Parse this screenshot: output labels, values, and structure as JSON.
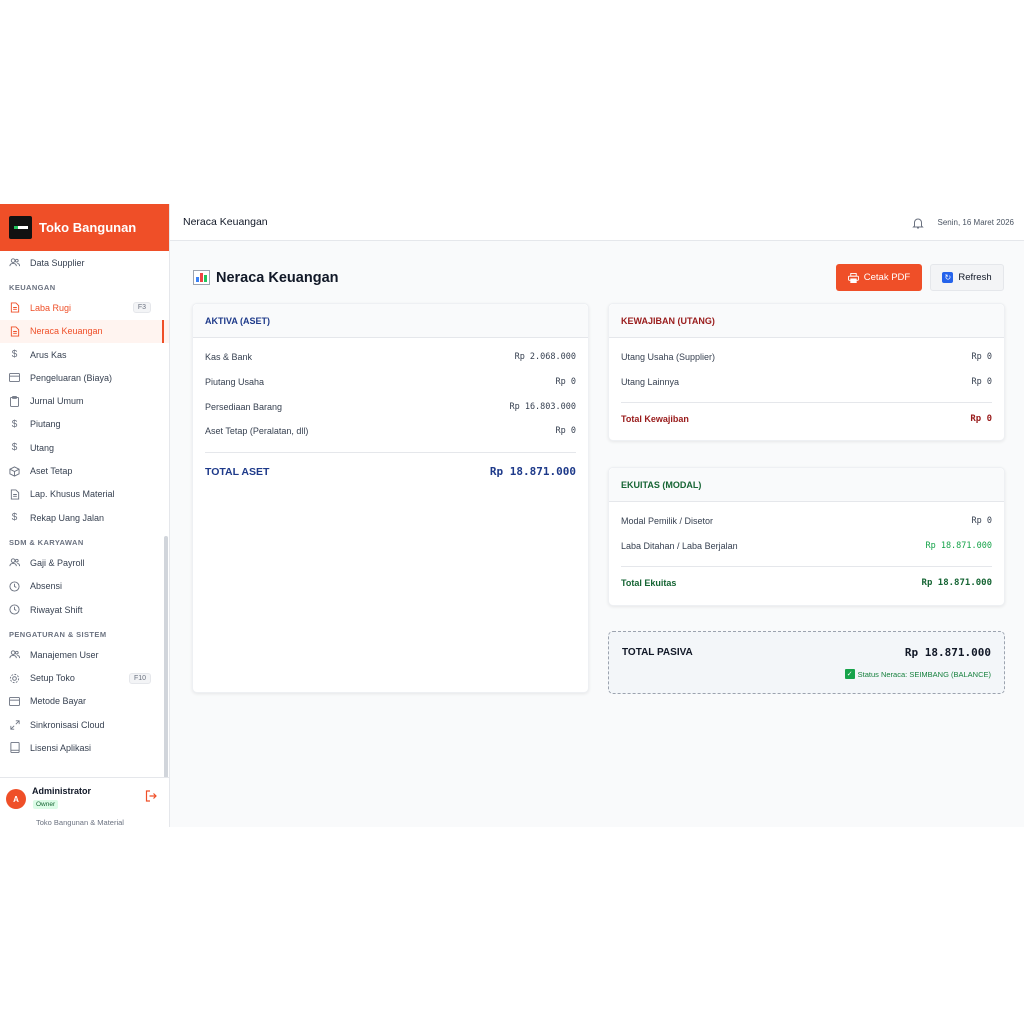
{
  "brand": {
    "title": "Toko Bangunan"
  },
  "sidebar": {
    "items_top": [
      {
        "label": "Data Supplier",
        "icon": "users-icon"
      }
    ],
    "section_keuangan": "KEUANGAN",
    "keuangan": [
      {
        "label": "Laba Rugi",
        "icon": "document-icon",
        "shortcut": "F3"
      },
      {
        "label": "Neraca Keuangan",
        "icon": "document-icon"
      },
      {
        "label": "Arus Kas",
        "icon": "dollar-icon"
      },
      {
        "label": "Pengeluaran (Biaya)",
        "icon": "card-icon"
      },
      {
        "label": "Jurnal Umum",
        "icon": "clipboard-icon"
      },
      {
        "label": "Piutang",
        "icon": "dollar-icon"
      },
      {
        "label": "Utang",
        "icon": "dollar-icon"
      },
      {
        "label": "Aset Tetap",
        "icon": "box-icon"
      },
      {
        "label": "Lap. Khusus Material",
        "icon": "document-icon"
      },
      {
        "label": "Rekap Uang Jalan",
        "icon": "dollar-icon"
      }
    ],
    "section_sdm": "SDM & KARYAWAN",
    "sdm": [
      {
        "label": "Gaji & Payroll",
        "icon": "users-icon"
      },
      {
        "label": "Absensi",
        "icon": "clock-icon"
      },
      {
        "label": "Riwayat Shift",
        "icon": "clock-icon"
      }
    ],
    "section_sistem": "PENGATURAN & SISTEM",
    "sistem": [
      {
        "label": "Manajemen User",
        "icon": "users-icon"
      },
      {
        "label": "Setup Toko",
        "icon": "gear-icon",
        "shortcut": "F10"
      },
      {
        "label": "Metode Bayar",
        "icon": "card-icon"
      },
      {
        "label": "Sinkronisasi Cloud",
        "icon": "expand-icon"
      },
      {
        "label": "Lisensi Aplikasi",
        "icon": "book-icon"
      }
    ]
  },
  "user": {
    "initial": "A",
    "name": "Administrator",
    "role": "Owner",
    "store": "Toko Bangunan & Material"
  },
  "topbar": {
    "title": "Neraca Keuangan",
    "date": "Senin, 16 Maret 2026"
  },
  "page": {
    "title": "Neraca Keuangan",
    "pdf_label": "Cetak PDF",
    "refresh_label": "Refresh"
  },
  "aktiva": {
    "title": "AKTIVA (ASET)",
    "rows": [
      {
        "label": "Kas & Bank",
        "value": "Rp 2.068.000"
      },
      {
        "label": "Piutang Usaha",
        "value": "Rp 0"
      },
      {
        "label": "Persediaan Barang",
        "value": "Rp 16.803.000"
      },
      {
        "label": "Aset Tetap (Peralatan, dll)",
        "value": "Rp 0"
      }
    ],
    "total_label": "TOTAL ASET",
    "total_value": "Rp 18.871.000"
  },
  "kewajiban": {
    "title": "KEWAJIBAN (UTANG)",
    "rows": [
      {
        "label": "Utang Usaha (Supplier)",
        "value": "Rp 0"
      },
      {
        "label": "Utang Lainnya",
        "value": "Rp 0"
      }
    ],
    "total_label": "Total Kewajiban",
    "total_value": "Rp 0"
  },
  "ekuitas": {
    "title": "EKUITAS (MODAL)",
    "rows": [
      {
        "label": "Modal Pemilik / Disetor",
        "value": "Rp 0"
      },
      {
        "label": "Laba Ditahan / Laba Berjalan",
        "value": "Rp 18.871.000"
      }
    ],
    "total_label": "Total Ekuitas",
    "total_value": "Rp 18.871.000"
  },
  "pasiva": {
    "label": "TOTAL PASIVA",
    "value": "Rp 18.871.000",
    "status": "Status Neraca: SEIMBANG (BALANCE)"
  },
  "colors": {
    "brand": "#ef4f28",
    "aktiva": "#1e3a8a",
    "kewajiban": "#991b1b",
    "ekuitas": "#166534",
    "positive": "#16a34a"
  }
}
